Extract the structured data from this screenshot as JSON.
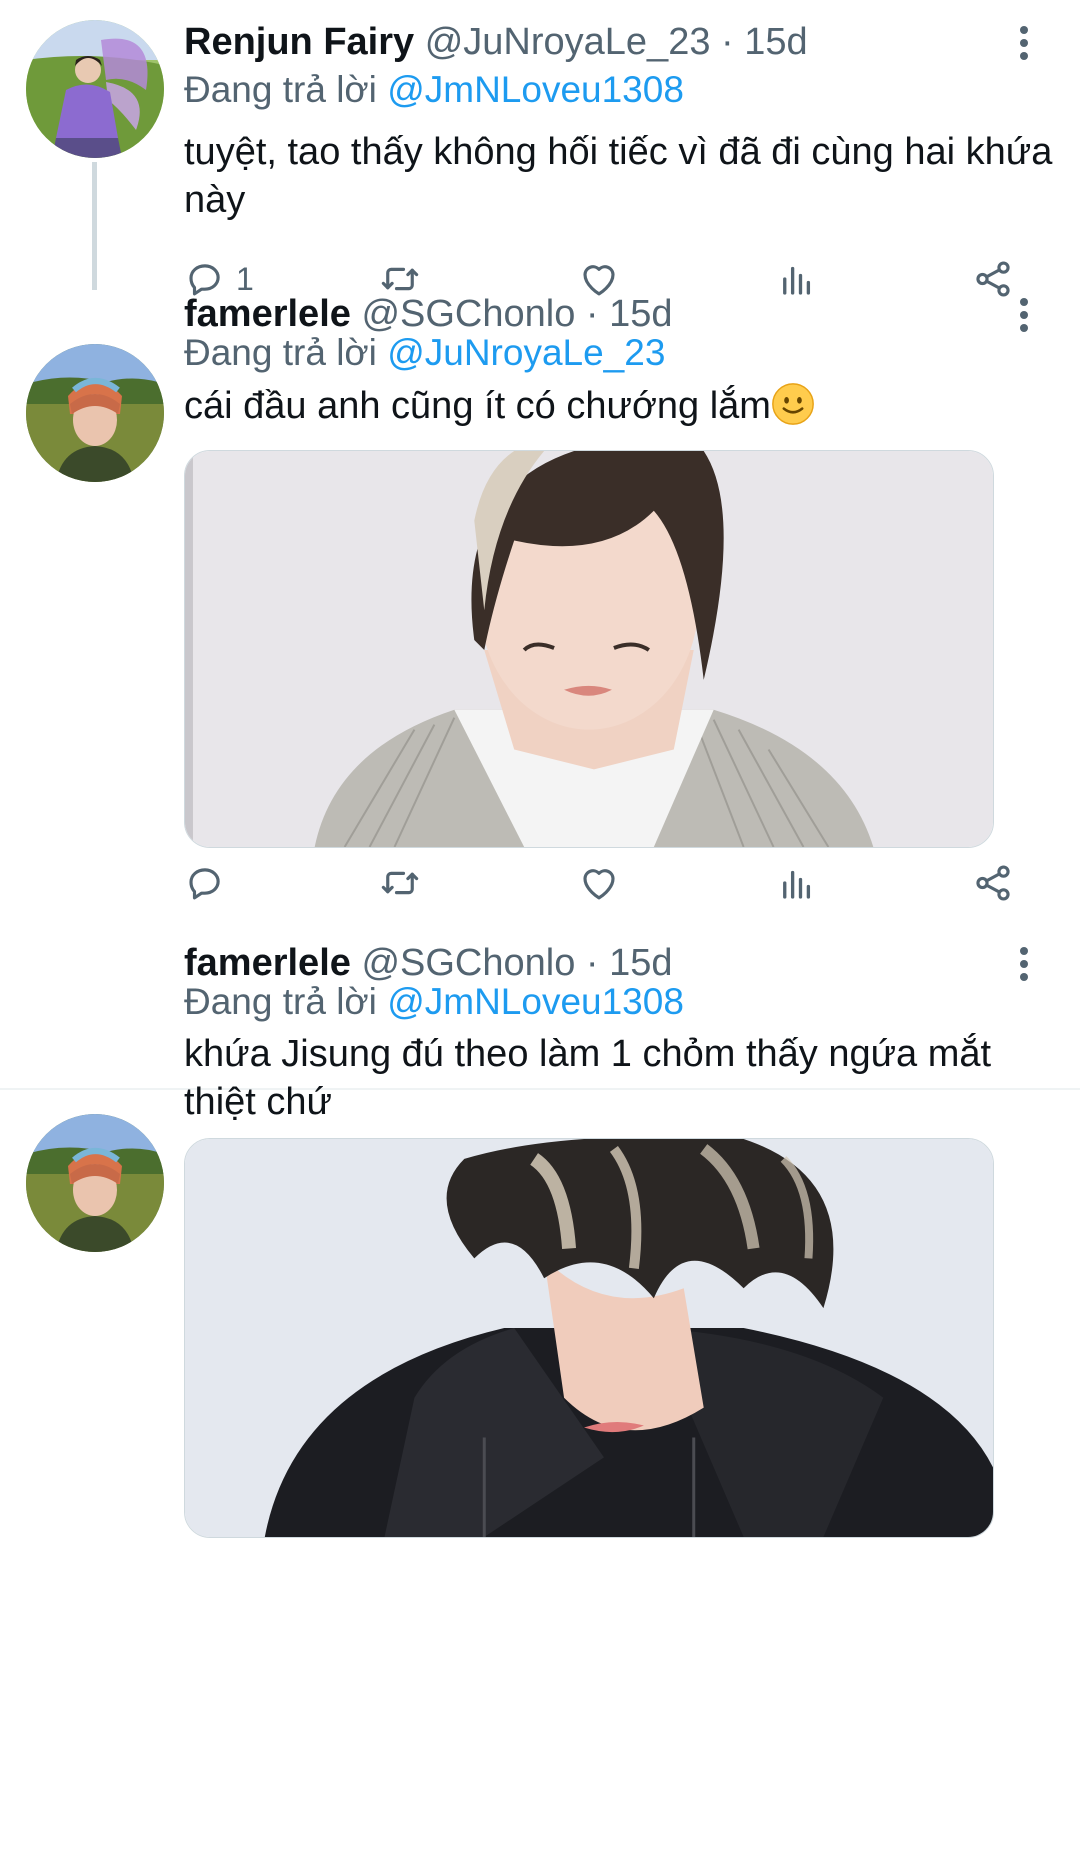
{
  "tweets": [
    {
      "name": "Renjun Fairy",
      "handle": "@JuNroyaLe_23",
      "time": "· 15d",
      "reply_prefix": "Đang trả lời",
      "reply_to": "@JmNLoveu1308",
      "text": "tuyệt, tao thấy không hối tiếc vì đã đi cùng hai khứa này",
      "reply_count": "1"
    },
    {
      "name": "famerlele",
      "handle": "@SGChonlo",
      "time": "· 15d",
      "reply_prefix": "Đang trả lời",
      "reply_to": "@JuNroyaLe_23",
      "text": "cái đầu anh cũng ít có chướng lắm",
      "emoji": "slightly-smiling-face-icon",
      "reply_count": ""
    },
    {
      "name": "famerlele",
      "handle": "@SGChonlo",
      "time": "· 15d",
      "reply_prefix": "Đang trả lời",
      "reply_to": "@JmNLoveu1308",
      "text": "khứa Jisung đú theo làm 1 chỏm thấy ngứa mắt thiệt chứ"
    }
  ],
  "icons": [
    "reply-icon",
    "retweet-icon",
    "like-icon",
    "views-icon",
    "share-icon",
    "more-options-icon"
  ],
  "colors": {
    "link": "#1d9bf0",
    "secondary_text": "#536471",
    "thread_line": "#cfd9de"
  }
}
